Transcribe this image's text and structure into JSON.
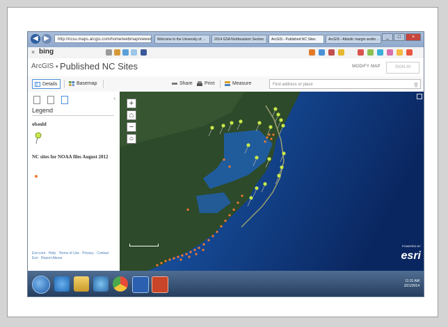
{
  "browser": {
    "back_icon": "back-arrow-icon",
    "forward_icon": "forward-arrow-icon",
    "address": "http://ncsu.maps.arcgis.com/home/webmap/viewer.html",
    "tabs": [
      {
        "label": "Welcome to the University of ...",
        "active": false
      },
      {
        "label": "2014 GSA Northeastern Section ...",
        "active": false
      },
      {
        "label": "ArcGIS - Published NC Sites",
        "active": true
      },
      {
        "label": "ArcGIS - Atlantic margin sedim...",
        "active": false
      }
    ],
    "window_buttons": [
      "minimize",
      "maximize",
      "close"
    ]
  },
  "bing_toolbar": {
    "close_label": "×",
    "logo": "bing"
  },
  "header": {
    "brand": "ArcGIS",
    "separator": "▾",
    "title": "Published NC Sites",
    "modify_label": "MODIFY MAP",
    "signin_label": "SIGN IN"
  },
  "toolbar": {
    "details_label": "Details",
    "basemap_label": "Basemap",
    "share_label": "Share",
    "print_label": "Print",
    "measure_label": "Measure",
    "search_placeholder": "Find address or place"
  },
  "panel": {
    "collapse_label": "‹",
    "legend_heading": "Legend",
    "layer1_name": "obauld",
    "layer2_name": "NC sites for NOAA files August 2012",
    "footer": "Esri.com · Help · Terms of Use · Privacy · Contact Esri · Report Abuse"
  },
  "map": {
    "zoom_in": "+",
    "home": "⌂",
    "zoom_out": "−",
    "locate": "○",
    "attribution_small": "POWERED BY",
    "attribution": "esri",
    "colors": {
      "ocean_deep": "#0d2f6e",
      "ocean_shelf": "#1f5fb0",
      "land": "#2d4a2a",
      "pin": "#c9e84a",
      "dot": "#f07a2c"
    }
  },
  "taskbar": {
    "clock_time": "11:31 AM",
    "clock_date": "3/21/2014",
    "apps": [
      "ie-icon",
      "explorer-icon",
      "media-icon",
      "chrome-icon",
      "word-icon",
      "powerpoint-icon"
    ]
  }
}
